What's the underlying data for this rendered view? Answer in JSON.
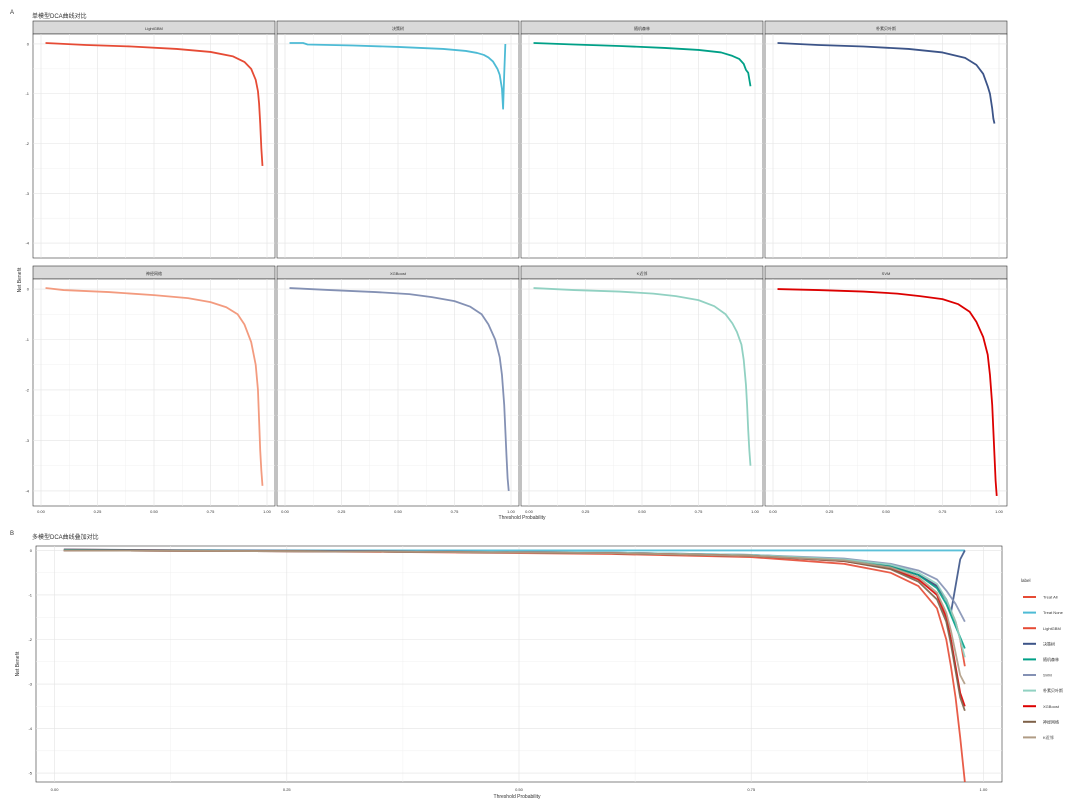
{
  "panel_a": {
    "tag": "A",
    "title": "单模型DCA曲线对比",
    "ylabel": "Net Benefit",
    "xlabel": "Threshold Probability",
    "x_ticks": [
      "0.00",
      "0.25",
      "0.50",
      "0.75",
      "1.00"
    ],
    "y_ticks": [
      "0",
      "-1",
      "-2",
      "-3",
      "-4"
    ],
    "facet_labels": [
      "LightGBM",
      "决策树",
      "随机森林",
      "朴素贝叶斯",
      "神经网络",
      "XGBoost",
      "K近邻",
      "SVM"
    ]
  },
  "panel_b": {
    "tag": "B",
    "title": "多模型DCA曲线叠加对比",
    "ylabel": "Net Benefit",
    "xlabel": "Threshold Probability",
    "x_ticks": [
      "0.00",
      "0.25",
      "0.50",
      "0.75",
      "1.00"
    ],
    "y_ticks": [
      "0",
      "-1",
      "-2",
      "-3",
      "-4",
      "-5"
    ],
    "legend_title": "label",
    "legend_items": [
      "Treat All",
      "Treat None",
      "LightGBM",
      "决策树",
      "随机森林",
      "SVM",
      "朴素贝叶斯",
      "XGBoost",
      "神经网络",
      "K近邻"
    ]
  },
  "colors": {
    "LightGBM": "#e64b35",
    "决策树": "#4dbbd5",
    "随机森林": "#00a087",
    "朴素贝叶斯": "#3c5488",
    "神经网络": "#f39b7f",
    "XGBoost": "#8491b4",
    "K近邻": "#91d1c2",
    "SVM": "#dc0000",
    "Treat All": "#e64b35",
    "Treat None": "#4dbbd5",
    "legend_随机森林": "#00a087",
    "legend_决策树": "#3c5488",
    "legend_SVM": "#8491b4",
    "legend_XGBoost": "#dc0000",
    "legend_神经网络": "#7e6148",
    "legend_K近邻": "#b09c85",
    "legend_朴素贝叶斯": "#91d1c2"
  },
  "chart_data": [
    {
      "type": "line",
      "panel": "A",
      "facet": "LightGBM",
      "xlim": [
        0,
        1
      ],
      "ylim": [
        -4.2,
        0.1
      ],
      "series": [
        {
          "name": "LightGBM",
          "x": [
            0.02,
            0.2,
            0.4,
            0.6,
            0.75,
            0.85,
            0.9,
            0.93,
            0.95,
            0.96,
            0.965,
            0.97,
            0.975,
            0.98
          ],
          "y": [
            0.02,
            -0.02,
            -0.05,
            -0.1,
            -0.16,
            -0.25,
            -0.36,
            -0.5,
            -0.72,
            -0.95,
            -1.2,
            -1.6,
            -2.1,
            -2.45
          ]
        }
      ]
    },
    {
      "type": "line",
      "panel": "A",
      "facet": "决策树",
      "xlim": [
        0,
        1
      ],
      "ylim": [
        -4.2,
        0.1
      ],
      "series": [
        {
          "name": "决策树",
          "x": [
            0.02,
            0.08,
            0.1,
            0.3,
            0.5,
            0.7,
            0.8,
            0.85,
            0.88,
            0.9,
            0.92,
            0.94,
            0.95,
            0.96,
            0.965,
            0.97,
            0.975
          ],
          "y": [
            0.02,
            0.02,
            -0.01,
            -0.03,
            -0.06,
            -0.1,
            -0.14,
            -0.18,
            -0.22,
            -0.27,
            -0.35,
            -0.5,
            -0.62,
            -0.9,
            -1.3,
            -0.6,
            0.0
          ]
        }
      ]
    },
    {
      "type": "line",
      "panel": "A",
      "facet": "随机森林",
      "xlim": [
        0,
        1
      ],
      "ylim": [
        -4.2,
        0.1
      ],
      "series": [
        {
          "name": "随机森林",
          "x": [
            0.02,
            0.2,
            0.4,
            0.6,
            0.75,
            0.85,
            0.9,
            0.93,
            0.95,
            0.96,
            0.97,
            0.98
          ],
          "y": [
            0.02,
            -0.01,
            -0.04,
            -0.08,
            -0.12,
            -0.17,
            -0.24,
            -0.3,
            -0.4,
            -0.52,
            -0.58,
            -0.85
          ]
        }
      ]
    },
    {
      "type": "line",
      "panel": "A",
      "facet": "朴素贝叶斯",
      "xlim": [
        0,
        1
      ],
      "ylim": [
        -4.2,
        0.1
      ],
      "series": [
        {
          "name": "朴素贝叶斯",
          "x": [
            0.02,
            0.2,
            0.4,
            0.6,
            0.75,
            0.85,
            0.9,
            0.93,
            0.95,
            0.96,
            0.97,
            0.975,
            0.98
          ],
          "y": [
            0.02,
            -0.02,
            -0.05,
            -0.1,
            -0.17,
            -0.28,
            -0.42,
            -0.6,
            -0.85,
            -1.0,
            -1.3,
            -1.5,
            -1.6
          ]
        }
      ]
    },
    {
      "type": "line",
      "panel": "A",
      "facet": "神经网络",
      "xlim": [
        0,
        1
      ],
      "ylim": [
        -4.2,
        0.1
      ],
      "series": [
        {
          "name": "神经网络",
          "x": [
            0.02,
            0.1,
            0.3,
            0.5,
            0.65,
            0.75,
            0.82,
            0.87,
            0.9,
            0.93,
            0.95,
            0.96,
            0.965,
            0.97,
            0.975,
            0.98
          ],
          "y": [
            0.02,
            -0.02,
            -0.06,
            -0.12,
            -0.18,
            -0.26,
            -0.36,
            -0.5,
            -0.7,
            -1.05,
            -1.5,
            -2.0,
            -2.6,
            -3.2,
            -3.6,
            -3.9
          ]
        }
      ]
    },
    {
      "type": "line",
      "panel": "A",
      "facet": "XGBoost",
      "xlim": [
        0,
        1
      ],
      "ylim": [
        -4.2,
        0.1
      ],
      "series": [
        {
          "name": "XGBoost",
          "x": [
            0.02,
            0.2,
            0.4,
            0.55,
            0.65,
            0.75,
            0.82,
            0.87,
            0.9,
            0.93,
            0.95,
            0.96,
            0.97,
            0.975,
            0.98,
            0.985,
            0.99
          ],
          "y": [
            0.02,
            -0.02,
            -0.06,
            -0.1,
            -0.16,
            -0.24,
            -0.35,
            -0.5,
            -0.7,
            -1.0,
            -1.35,
            -1.7,
            -2.3,
            -2.8,
            -3.3,
            -3.75,
            -4.0
          ]
        }
      ]
    },
    {
      "type": "line",
      "panel": "A",
      "facet": "K近邻",
      "xlim": [
        0,
        1
      ],
      "ylim": [
        -4.2,
        0.1
      ],
      "series": [
        {
          "name": "K近邻",
          "x": [
            0.02,
            0.2,
            0.4,
            0.55,
            0.65,
            0.75,
            0.82,
            0.87,
            0.9,
            0.92,
            0.94,
            0.95,
            0.96,
            0.965,
            0.97,
            0.975,
            0.98
          ],
          "y": [
            0.02,
            -0.02,
            -0.05,
            -0.09,
            -0.14,
            -0.22,
            -0.34,
            -0.5,
            -0.68,
            -0.85,
            -1.1,
            -1.4,
            -1.9,
            -2.3,
            -2.8,
            -3.2,
            -3.5
          ]
        }
      ]
    },
    {
      "type": "line",
      "panel": "A",
      "facet": "SVM",
      "xlim": [
        0,
        1
      ],
      "ylim": [
        -4.2,
        0.1
      ],
      "series": [
        {
          "name": "SVM",
          "x": [
            0.02,
            0.2,
            0.4,
            0.55,
            0.65,
            0.75,
            0.82,
            0.87,
            0.9,
            0.93,
            0.95,
            0.96,
            0.97,
            0.975,
            0.98,
            0.985,
            0.99
          ],
          "y": [
            0.0,
            -0.02,
            -0.05,
            -0.09,
            -0.14,
            -0.2,
            -0.3,
            -0.45,
            -0.65,
            -0.95,
            -1.3,
            -1.7,
            -2.3,
            -2.8,
            -3.3,
            -3.8,
            -4.1
          ]
        }
      ]
    },
    {
      "type": "line",
      "panel": "B",
      "xlim": [
        -0.02,
        1.02
      ],
      "ylim": [
        -5.2,
        0.1
      ],
      "series": [
        {
          "name": "Treat All",
          "x": [
            0.01,
            0.2,
            0.4,
            0.6,
            0.75,
            0.85,
            0.9,
            0.93,
            0.95,
            0.96,
            0.965,
            0.97,
            0.975,
            0.98
          ],
          "y": [
            0.02,
            -0.01,
            -0.04,
            -0.08,
            -0.15,
            -0.3,
            -0.5,
            -0.8,
            -1.3,
            -2.0,
            -2.6,
            -3.3,
            -4.2,
            -5.2
          ]
        },
        {
          "name": "Treat None",
          "x": [
            0.01,
            0.98
          ],
          "y": [
            0.0,
            0.0
          ]
        },
        {
          "name": "LightGBM",
          "x": [
            0.01,
            0.3,
            0.6,
            0.75,
            0.85,
            0.9,
            0.93,
            0.95,
            0.96,
            0.97,
            0.975,
            0.98
          ],
          "y": [
            0.0,
            -0.02,
            -0.06,
            -0.12,
            -0.22,
            -0.35,
            -0.55,
            -0.8,
            -1.1,
            -1.6,
            -2.0,
            -2.6
          ]
        },
        {
          "name": "决策树",
          "x": [
            0.01,
            0.3,
            0.6,
            0.75,
            0.85,
            0.9,
            0.93,
            0.95,
            0.96,
            0.965,
            0.97,
            0.975,
            0.98
          ],
          "y": [
            0.02,
            -0.01,
            -0.05,
            -0.1,
            -0.2,
            -0.35,
            -0.55,
            -0.8,
            -1.1,
            -1.4,
            -0.8,
            -0.2,
            0.0
          ]
        },
        {
          "name": "随机森林",
          "x": [
            0.01,
            0.3,
            0.6,
            0.75,
            0.85,
            0.9,
            0.93,
            0.95,
            0.96,
            0.97,
            0.98
          ],
          "y": [
            0.01,
            -0.02,
            -0.06,
            -0.12,
            -0.22,
            -0.36,
            -0.55,
            -0.85,
            -1.2,
            -1.7,
            -2.2
          ]
        },
        {
          "name": "SVM",
          "x": [
            0.01,
            0.3,
            0.6,
            0.75,
            0.85,
            0.9,
            0.93,
            0.95,
            0.96,
            0.97,
            0.98
          ],
          "y": [
            0.0,
            -0.02,
            -0.05,
            -0.1,
            -0.18,
            -0.3,
            -0.45,
            -0.65,
            -0.9,
            -1.2,
            -1.6
          ]
        },
        {
          "name": "朴素贝叶斯",
          "x": [
            0.01,
            0.3,
            0.6,
            0.75,
            0.85,
            0.9,
            0.93,
            0.95,
            0.96,
            0.97,
            0.98
          ],
          "y": [
            0.0,
            -0.02,
            -0.05,
            -0.1,
            -0.2,
            -0.32,
            -0.5,
            -0.75,
            -1.1,
            -1.6,
            -2.4
          ]
        },
        {
          "name": "XGBoost",
          "x": [
            0.01,
            0.3,
            0.6,
            0.75,
            0.85,
            0.9,
            0.93,
            0.95,
            0.96,
            0.965,
            0.97,
            0.975,
            0.98
          ],
          "y": [
            0.0,
            -0.02,
            -0.06,
            -0.12,
            -0.24,
            -0.4,
            -0.65,
            -1.0,
            -1.5,
            -2.0,
            -2.6,
            -3.2,
            -3.5
          ]
        },
        {
          "name": "神经网络",
          "x": [
            0.01,
            0.3,
            0.6,
            0.75,
            0.85,
            0.9,
            0.93,
            0.95,
            0.96,
            0.965,
            0.97,
            0.975,
            0.98
          ],
          "y": [
            0.0,
            -0.02,
            -0.06,
            -0.12,
            -0.24,
            -0.42,
            -0.7,
            -1.1,
            -1.6,
            -2.1,
            -2.7,
            -3.3,
            -3.6
          ]
        },
        {
          "name": "K近邻",
          "x": [
            0.01,
            0.3,
            0.6,
            0.75,
            0.85,
            0.9,
            0.93,
            0.95,
            0.96,
            0.965,
            0.97,
            0.975,
            0.98
          ],
          "y": [
            0.0,
            -0.02,
            -0.06,
            -0.12,
            -0.22,
            -0.38,
            -0.6,
            -0.95,
            -1.4,
            -1.8,
            -2.3,
            -2.8,
            -3.0
          ]
        }
      ]
    }
  ]
}
